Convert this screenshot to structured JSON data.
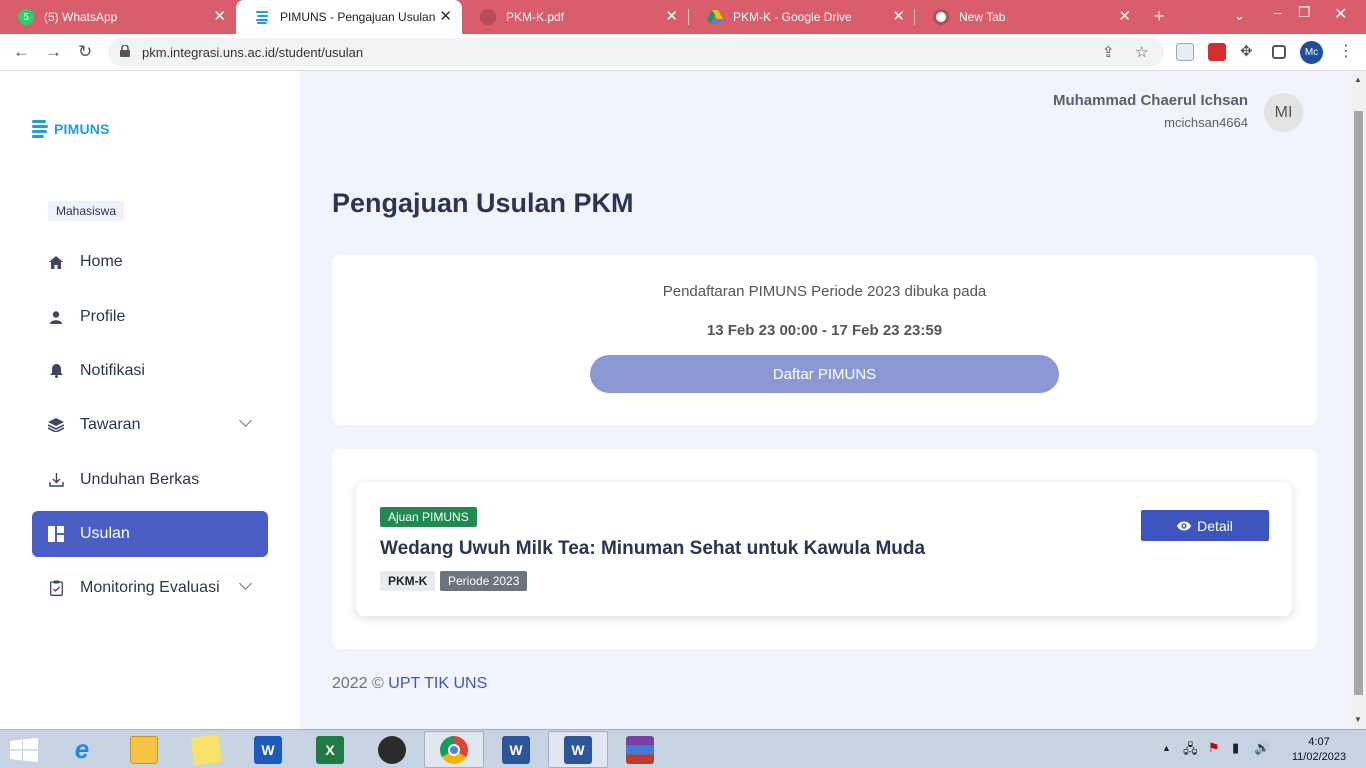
{
  "browser": {
    "tabs": [
      {
        "title": "(5) WhatsApp",
        "icon": "whatsapp-icon",
        "badge": "5"
      },
      {
        "title": "PIMUNS - Pengajuan Usulan",
        "icon": "pimuns-icon"
      },
      {
        "title": "PKM-K.pdf",
        "icon": "globe-icon"
      },
      {
        "title": "PKM-K - Google Drive",
        "icon": "google-drive-icon"
      },
      {
        "title": "New Tab",
        "icon": "chrome-icon"
      }
    ],
    "url": "pkm.integrasi.uns.ac.id/student/usulan",
    "profile_initials": "Mc",
    "colors": {
      "tabbar": "#d95d6a"
    }
  },
  "app": {
    "logo_text": "PIMUNS",
    "role": "Mahasiswa",
    "menu": [
      {
        "label": "Home",
        "icon": "home-icon"
      },
      {
        "label": "Profile",
        "icon": "user-icon"
      },
      {
        "label": "Notifikasi",
        "icon": "bell-icon"
      },
      {
        "label": "Tawaran",
        "icon": "layers-icon",
        "expandable": true
      },
      {
        "label": "Unduhan Berkas",
        "icon": "download-icon"
      },
      {
        "label": "Usulan",
        "icon": "dashboard-icon",
        "active": true
      },
      {
        "label": "Monitoring Evaluasi",
        "icon": "clipboard-icon",
        "expandable": true
      }
    ],
    "user": {
      "name": "Muhammad Chaerul Ichsan",
      "username": "mcichsan4664",
      "initials": "MI"
    },
    "page_title": "Pengajuan Usulan PKM",
    "registration": {
      "text": "Pendaftaran PIMUNS Periode 2023 dibuka pada",
      "dates": "13 Feb 23 00:00 - 17 Feb 23 23:59",
      "button": "Daftar PIMUNS"
    },
    "proposal": {
      "status": "Ajuan PIMUNS",
      "title": "Wedang Uwuh Milk Tea: Minuman Sehat untuk Kawula Muda",
      "category": "PKM-K",
      "period": "Periode 2023",
      "detail_button": "Detail"
    },
    "footer": {
      "copyright": "2022 ©",
      "link": "UPT TIK UNS"
    },
    "colors": {
      "accent": "#4a5fc5",
      "success": "#218a53",
      "background": "#f1f4fc"
    }
  },
  "taskbar": {
    "apps": [
      "internet-explorer-icon",
      "file-explorer-icon",
      "sticky-notes-icon",
      "word-icon",
      "excel-icon",
      "obs-icon",
      "chrome-icon",
      "word-doc-icon",
      "word-doc-icon",
      "winrar-icon"
    ],
    "time": "4:07",
    "date": "11/02/2023"
  }
}
